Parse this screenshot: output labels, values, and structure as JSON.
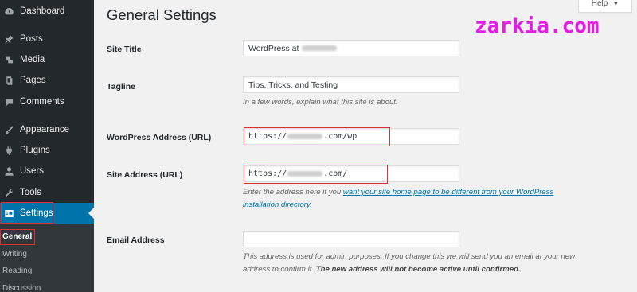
{
  "sidebar": {
    "items": [
      {
        "label": "Dashboard",
        "icon": "dashboard-icon"
      },
      {
        "label": "Posts",
        "icon": "pin-icon"
      },
      {
        "label": "Media",
        "icon": "media-icon"
      },
      {
        "label": "Pages",
        "icon": "pages-icon"
      },
      {
        "label": "Comments",
        "icon": "comment-icon"
      },
      {
        "label": "Appearance",
        "icon": "brush-icon"
      },
      {
        "label": "Plugins",
        "icon": "plugin-icon"
      },
      {
        "label": "Users",
        "icon": "users-icon"
      },
      {
        "label": "Tools",
        "icon": "wrench-icon"
      },
      {
        "label": "Settings",
        "icon": "settings-icon"
      }
    ],
    "submenu": [
      "General",
      "Writing",
      "Reading",
      "Discussion"
    ]
  },
  "header": {
    "title": "General Settings",
    "help_label": "Help",
    "watermark": "zarkia.com"
  },
  "form": {
    "site_title": {
      "label": "Site Title",
      "value_prefix": "WordPress at"
    },
    "tagline": {
      "label": "Tagline",
      "value": "Tips, Tricks, and Testing",
      "description": "In a few words, explain what this site is about."
    },
    "wp_address": {
      "label": "WordPress Address (URL)",
      "value_prefix": "https://",
      "value_suffix": ".com/wp"
    },
    "site_address": {
      "label": "Site Address (URL)",
      "value_prefix": "https://",
      "value_suffix": ".com/",
      "description_before": "Enter the address here if you",
      "description_link": "want your site home page to be different from your WordPress",
      "description_link2": "installation directory",
      "description_after": "."
    },
    "email": {
      "label": "Email Address",
      "value": "",
      "description_line1": "This address is used for admin purposes. If you change this we will send you an email at your new",
      "description_line2": "address to confirm it.",
      "description_bold": "The new address will not become active until confirmed."
    }
  },
  "colors": {
    "sidebar": "#23282d",
    "active": "#0073aa",
    "highlight": "#dc3232",
    "watermark": "#e61ce6"
  }
}
